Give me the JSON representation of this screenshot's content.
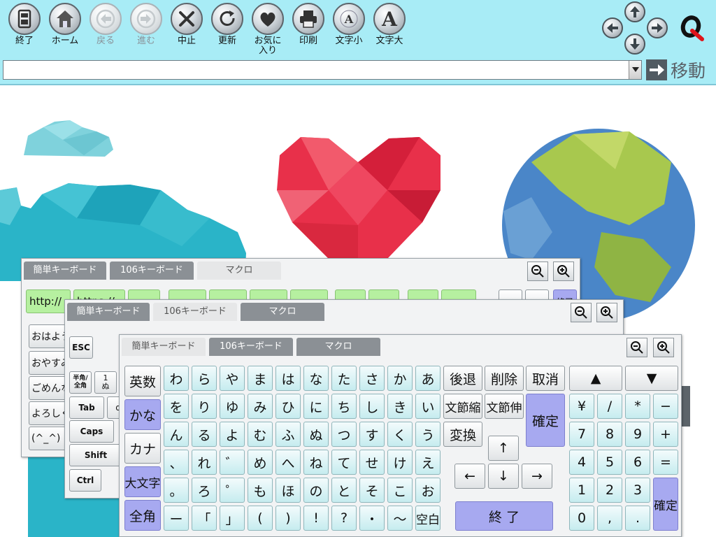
{
  "toolbar": {
    "buttons": [
      {
        "id": "exit",
        "label": "終了",
        "icon": "exit-icon",
        "enabled": true
      },
      {
        "id": "home",
        "label": "ホーム",
        "icon": "home-icon",
        "enabled": true
      },
      {
        "id": "back",
        "label": "戻る",
        "icon": "arrow-left-icon",
        "enabled": false
      },
      {
        "id": "forward",
        "label": "進む",
        "icon": "arrow-right-icon",
        "enabled": false
      },
      {
        "id": "stop",
        "label": "中止",
        "icon": "stop-x-icon",
        "enabled": true
      },
      {
        "id": "refresh",
        "label": "更新",
        "icon": "refresh-icon",
        "enabled": true
      },
      {
        "id": "favorites",
        "label": "お気に\n入り",
        "icon": "heart-icon",
        "enabled": true
      },
      {
        "id": "print",
        "label": "印刷",
        "icon": "printer-icon",
        "enabled": true
      },
      {
        "id": "text_small",
        "label": "文字小",
        "icon": "text-small-icon",
        "enabled": true
      },
      {
        "id": "text_large",
        "label": "文字大",
        "icon": "text-large-icon",
        "enabled": true
      }
    ],
    "scroll_arrows": [
      "up",
      "left",
      "right",
      "down"
    ],
    "logo": "q-logo-icon"
  },
  "address": {
    "value": "",
    "go_label": "移動"
  },
  "colors": {
    "toolbar_bg": "#a8ecf6",
    "key_mint": "#c6ecef",
    "key_lavender": "#a7a9f0",
    "key_green": "#b6f0a0"
  },
  "tabs": {
    "simple": "簡単キーボード",
    "jis106": "106キーボード",
    "macro": "マクロ"
  },
  "macro_panel": {
    "url_key": "http://",
    "url_key2": "https://",
    "phrases": [
      "おはよう",
      "おやすみ",
      "ごめんな",
      "よろしく",
      "(^_^)"
    ],
    "extra_label": "終了"
  },
  "jis_panel": {
    "esc": "ESC",
    "hankaku": "半角/\n全角",
    "one": "1\nぬ",
    "tab": "Tab",
    "q": "q",
    "caps": "Caps",
    "shift": "Shift",
    "ctrl": "Ctrl"
  },
  "simple_keyboard": {
    "mode_keys": [
      "英数",
      "かな",
      "カナ",
      "大文字",
      "全角"
    ],
    "kana_rows": [
      [
        "わ",
        "ら",
        "や",
        "ま",
        "は",
        "な",
        "た",
        "さ",
        "か",
        "あ"
      ],
      [
        "を",
        "り",
        "ゆ",
        "み",
        "ひ",
        "に",
        "ち",
        "し",
        "き",
        "い"
      ],
      [
        "ん",
        "る",
        "よ",
        "む",
        "ふ",
        "ぬ",
        "つ",
        "す",
        "く",
        "う"
      ],
      [
        "、",
        "れ",
        "゛",
        "め",
        "へ",
        "ね",
        "て",
        "せ",
        "け",
        "え"
      ],
      [
        "。",
        "ろ",
        "゜",
        "も",
        "ほ",
        "の",
        "と",
        "そ",
        "こ",
        "お"
      ],
      [
        "ー",
        "「",
        "」",
        "(",
        ")",
        "!",
        "?",
        "・",
        "〜",
        "空白"
      ]
    ],
    "edit_keys": {
      "backspace": "後退",
      "delete": "削除",
      "cancel": "取消",
      "shrink": "文節縮",
      "extend": "文節伸",
      "convert": "変換",
      "confirm": "確定"
    },
    "nav_keys": {
      "up": "↑",
      "left": "←",
      "down": "↓",
      "right": "→",
      "page_up": "▲",
      "page_down": "▼"
    },
    "end_key": "終 了",
    "numpad": [
      [
        "¥",
        "/",
        "*",
        "−"
      ],
      [
        "7",
        "8",
        "9",
        "+"
      ],
      [
        "4",
        "5",
        "6",
        "="
      ],
      [
        "1",
        "2",
        "3"
      ],
      [
        "0",
        ",",
        "."
      ]
    ],
    "numpad_confirm": "確定"
  }
}
